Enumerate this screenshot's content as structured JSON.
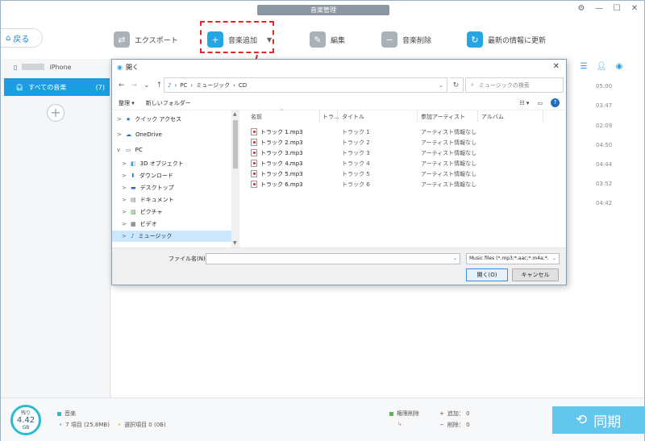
{
  "app": {
    "title": "音楽管理",
    "back_label": "戻る",
    "toolbar": {
      "export": "エクスポート",
      "add_music": "音楽追加",
      "edit": "編集",
      "delete": "音楽削除",
      "refresh": "最新の情報に更新"
    },
    "sidebar": {
      "device": "iPhone",
      "music_label": "すべての音楽",
      "music_count": "(7)"
    },
    "durations": [
      "05:00",
      "03:47",
      "02:09",
      "04:50",
      "04:44",
      "03:52",
      "04:42"
    ],
    "bottom": {
      "storage_label": "残り",
      "storage_value": "4.42",
      "storage_unit": "GB",
      "category": "音楽",
      "items": "7 項目 (25.8MB)",
      "selected": "選択項目 0 (0B)",
      "perm_delete": "権限削除",
      "added": "追加： 0",
      "deleted": "削除： 0",
      "sync": "同期"
    }
  },
  "dialog": {
    "title": "開く",
    "breadcrumb": [
      "PC",
      "ミュージック",
      "CD"
    ],
    "search_placeholder": "ミュージックの検索",
    "organize": "整理 ▾",
    "new_folder": "新しいフォルダー",
    "tree": [
      {
        "label": "クイック アクセス",
        "exp": ">"
      },
      {
        "label": "OneDrive",
        "exp": ">"
      },
      {
        "label": "PC",
        "exp": "v"
      },
      {
        "label": "3D オブジェクト",
        "exp": ">"
      },
      {
        "label": "ダウンロード",
        "exp": ">"
      },
      {
        "label": "デスクトップ",
        "exp": ">"
      },
      {
        "label": "ドキュメント",
        "exp": ">"
      },
      {
        "label": "ピクチャ",
        "exp": ">"
      },
      {
        "label": "ビデオ",
        "exp": ">"
      },
      {
        "label": "ミュージック",
        "exp": ">"
      }
    ],
    "columns": {
      "name": "名前",
      "track": "トラ...",
      "title": "タイトル",
      "artist": "参加アーティスト",
      "album": "アルバム"
    },
    "files": [
      {
        "name": "トラック 1.mp3",
        "title": "トラック 1",
        "artist": "アーティスト情報なし"
      },
      {
        "name": "トラック 2.mp3",
        "title": "トラック 2",
        "artist": "アーティスト情報なし"
      },
      {
        "name": "トラック 3.mp3",
        "title": "トラック 3",
        "artist": "アーティスト情報なし"
      },
      {
        "name": "トラック 4.mp3",
        "title": "トラック 4",
        "artist": "アーティスト情報なし"
      },
      {
        "name": "トラック 5.mp3",
        "title": "トラック 5",
        "artist": "アーティスト情報なし"
      },
      {
        "name": "トラック 6.mp3",
        "title": "トラック 6",
        "artist": "アーティスト情報なし"
      }
    ],
    "filename_label": "ファイル名(N):",
    "filename_value": "",
    "filter": "Music files (*.mp3;*.aac;*.m4a;*.",
    "open_button": "開く(O)",
    "cancel_button": "キャンセル"
  }
}
